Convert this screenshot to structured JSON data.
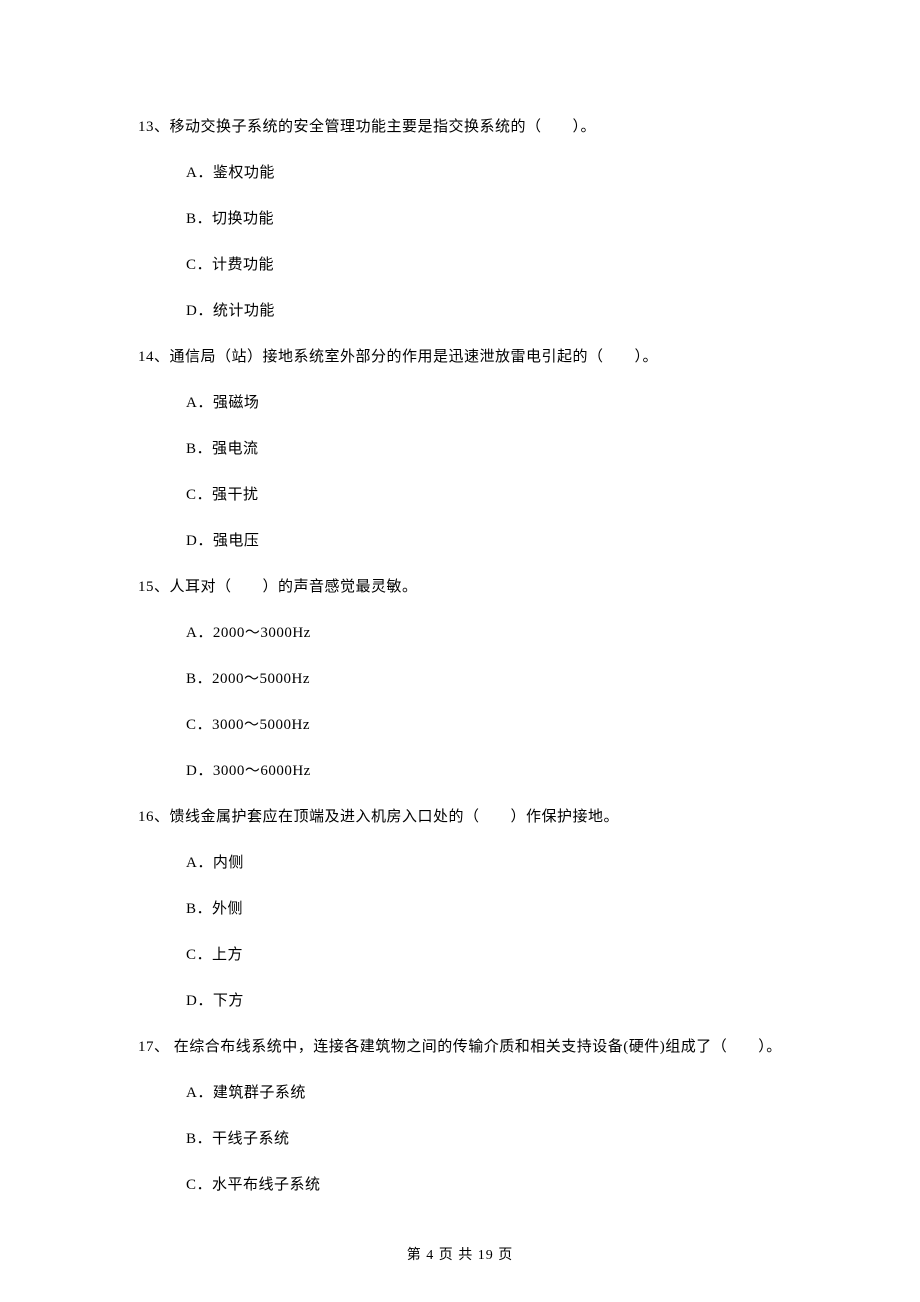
{
  "questions": [
    {
      "number": "13",
      "prompt": "移动交换子系统的安全管理功能主要是指交换系统的（　　）。",
      "options": [
        "A．鉴权功能",
        "B．切换功能",
        "C．计费功能",
        "D．统计功能"
      ]
    },
    {
      "number": "14",
      "prompt": "通信局（站）接地系统室外部分的作用是迅速泄放雷电引起的（　　）。",
      "options": [
        "A．强磁场",
        "B．强电流",
        "C．强干扰",
        "D．强电压"
      ]
    },
    {
      "number": "15",
      "prompt": "人耳对（　　）的声音感觉最灵敏。",
      "options": [
        "A．2000～3000Hz",
        "B．2000～5000Hz",
        "C．3000～5000Hz",
        "D．3000～6000Hz"
      ]
    },
    {
      "number": "16",
      "prompt": "馈线金属护套应在顶端及进入机房入口处的（　　）作保护接地。",
      "options": [
        "A．内侧",
        "B．外侧",
        "C．上方",
        "D．下方"
      ]
    },
    {
      "number": "17",
      "prompt": " 在综合布线系统中，连接各建筑物之间的传输介质和相关支持设备(硬件)组成了（　　）。",
      "options": [
        "A．建筑群子系统",
        "B．干线子系统",
        "C．水平布线子系统"
      ]
    }
  ],
  "footer": "第 4 页 共 19 页"
}
